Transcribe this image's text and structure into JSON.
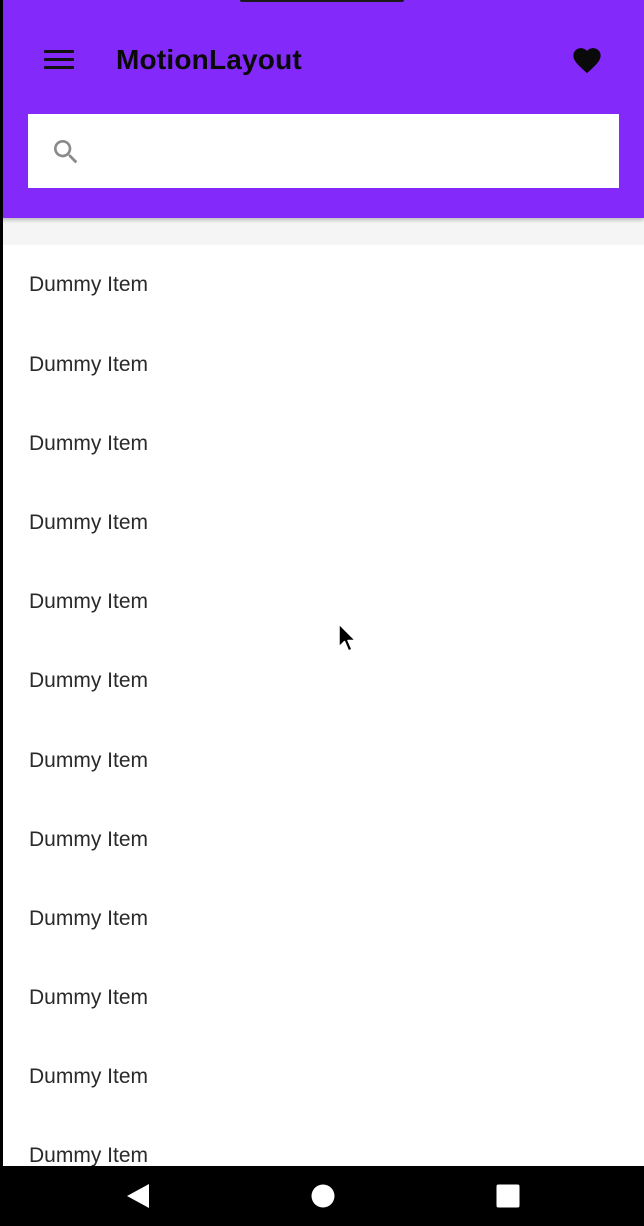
{
  "app_bar": {
    "title": "MotionLayout",
    "background_color": "#8329fa",
    "menu_icon": "hamburger-menu-icon",
    "favorite_icon": "heart-icon"
  },
  "search": {
    "icon": "search-icon",
    "value": "",
    "placeholder": ""
  },
  "list": {
    "items": [
      "Dummy Item",
      "Dummy Item",
      "Dummy Item",
      "Dummy Item",
      "Dummy Item",
      "Dummy Item",
      "Dummy Item",
      "Dummy Item",
      "Dummy Item",
      "Dummy Item",
      "Dummy Item",
      "Dummy Item"
    ]
  },
  "nav_bar": {
    "back_icon": "back-triangle-icon",
    "home_icon": "home-circle-icon",
    "recents_icon": "recents-square-icon"
  }
}
